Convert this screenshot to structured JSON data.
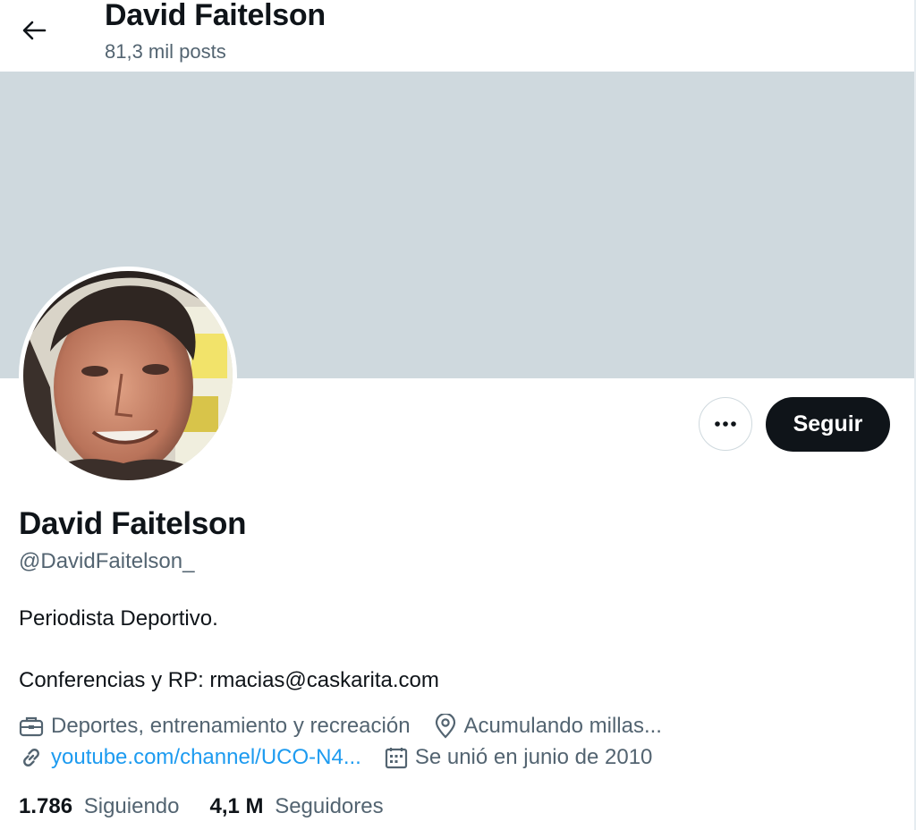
{
  "header": {
    "title": "David Faitelson",
    "post_count": "81,3 mil posts"
  },
  "profile": {
    "name": "David Faitelson",
    "handle": "@DavidFaitelson_",
    "bio_line1": "Periodista Deportivo.",
    "bio_line2": "Conferencias y RP: rmacias@caskarita.com",
    "category": "Deportes, entrenamiento y recreación",
    "location": "Acumulando millas...",
    "website": "youtube.com/channel/UCO-N4...",
    "joined": "Se unió en junio de 2010"
  },
  "actions": {
    "follow_label": "Seguir"
  },
  "stats": {
    "following_count": "1.786",
    "following_label": "Siguiendo",
    "followers_count": "4,1 M",
    "followers_label": "Seguidores"
  },
  "colors": {
    "banner": "#cfd9de",
    "link": "#1d9bf0",
    "secondary_text": "#536471",
    "button_dark": "#0f1419"
  },
  "icons": {
    "back": "arrow-left-icon",
    "more": "more-dots-icon",
    "category": "briefcase-icon",
    "location": "location-pin-icon",
    "website": "link-icon",
    "joined": "calendar-icon"
  }
}
